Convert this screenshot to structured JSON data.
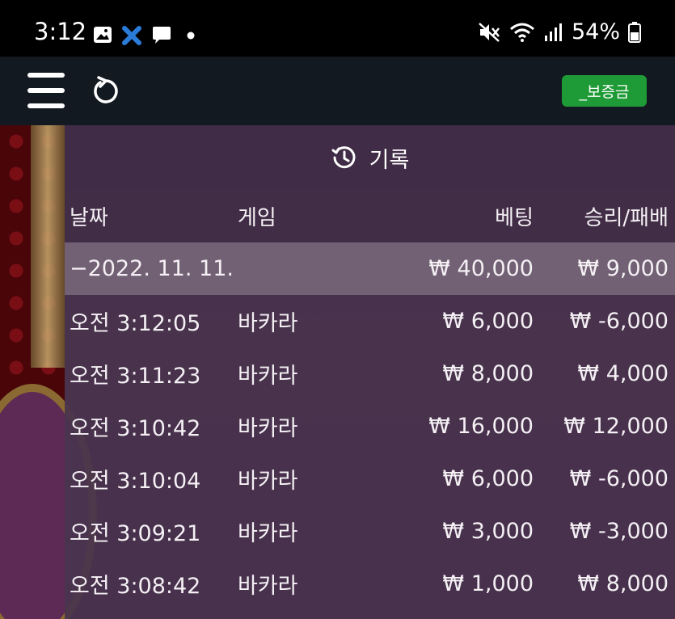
{
  "status_bar": {
    "time": "3:12",
    "battery_percent": "54%",
    "left_icons": [
      "gallery-icon",
      "app-x-icon",
      "chat-icon",
      "dot-icon"
    ],
    "right_icons": [
      "mute-icon",
      "wifi-icon",
      "signal-icon",
      "battery-icon"
    ]
  },
  "app_bar": {
    "deposit_label": "_보증금"
  },
  "history": {
    "title": "기록",
    "columns": {
      "date": "날짜",
      "game": "게임",
      "bet": "베팅",
      "win_loss": "승리/패배"
    },
    "summary": {
      "date": "−2022. 11. 11.",
      "bet": "₩ 40,000",
      "win_loss": "₩ 9,000"
    },
    "rows": [
      {
        "time": "오전 3:12:05",
        "game": "바카라",
        "bet": "₩ 6,000",
        "win_loss": "₩ -6,000"
      },
      {
        "time": "오전 3:11:23",
        "game": "바카라",
        "bet": "₩ 8,000",
        "win_loss": "₩ 4,000"
      },
      {
        "time": "오전 3:10:42",
        "game": "바카라",
        "bet": "₩ 16,000",
        "win_loss": "₩ 12,000"
      },
      {
        "time": "오전 3:10:04",
        "game": "바카라",
        "bet": "₩ 6,000",
        "win_loss": "₩ -6,000"
      },
      {
        "time": "오전 3:09:21",
        "game": "바카라",
        "bet": "₩ 3,000",
        "win_loss": "₩ -3,000"
      },
      {
        "time": "오전 3:08:42",
        "game": "바카라",
        "bet": "₩ 1,000",
        "win_loss": "₩ 8,000"
      }
    ]
  },
  "colors": {
    "deposit_button": "#1e9a36",
    "app_bar": "#121920",
    "panel": "#48344e"
  }
}
